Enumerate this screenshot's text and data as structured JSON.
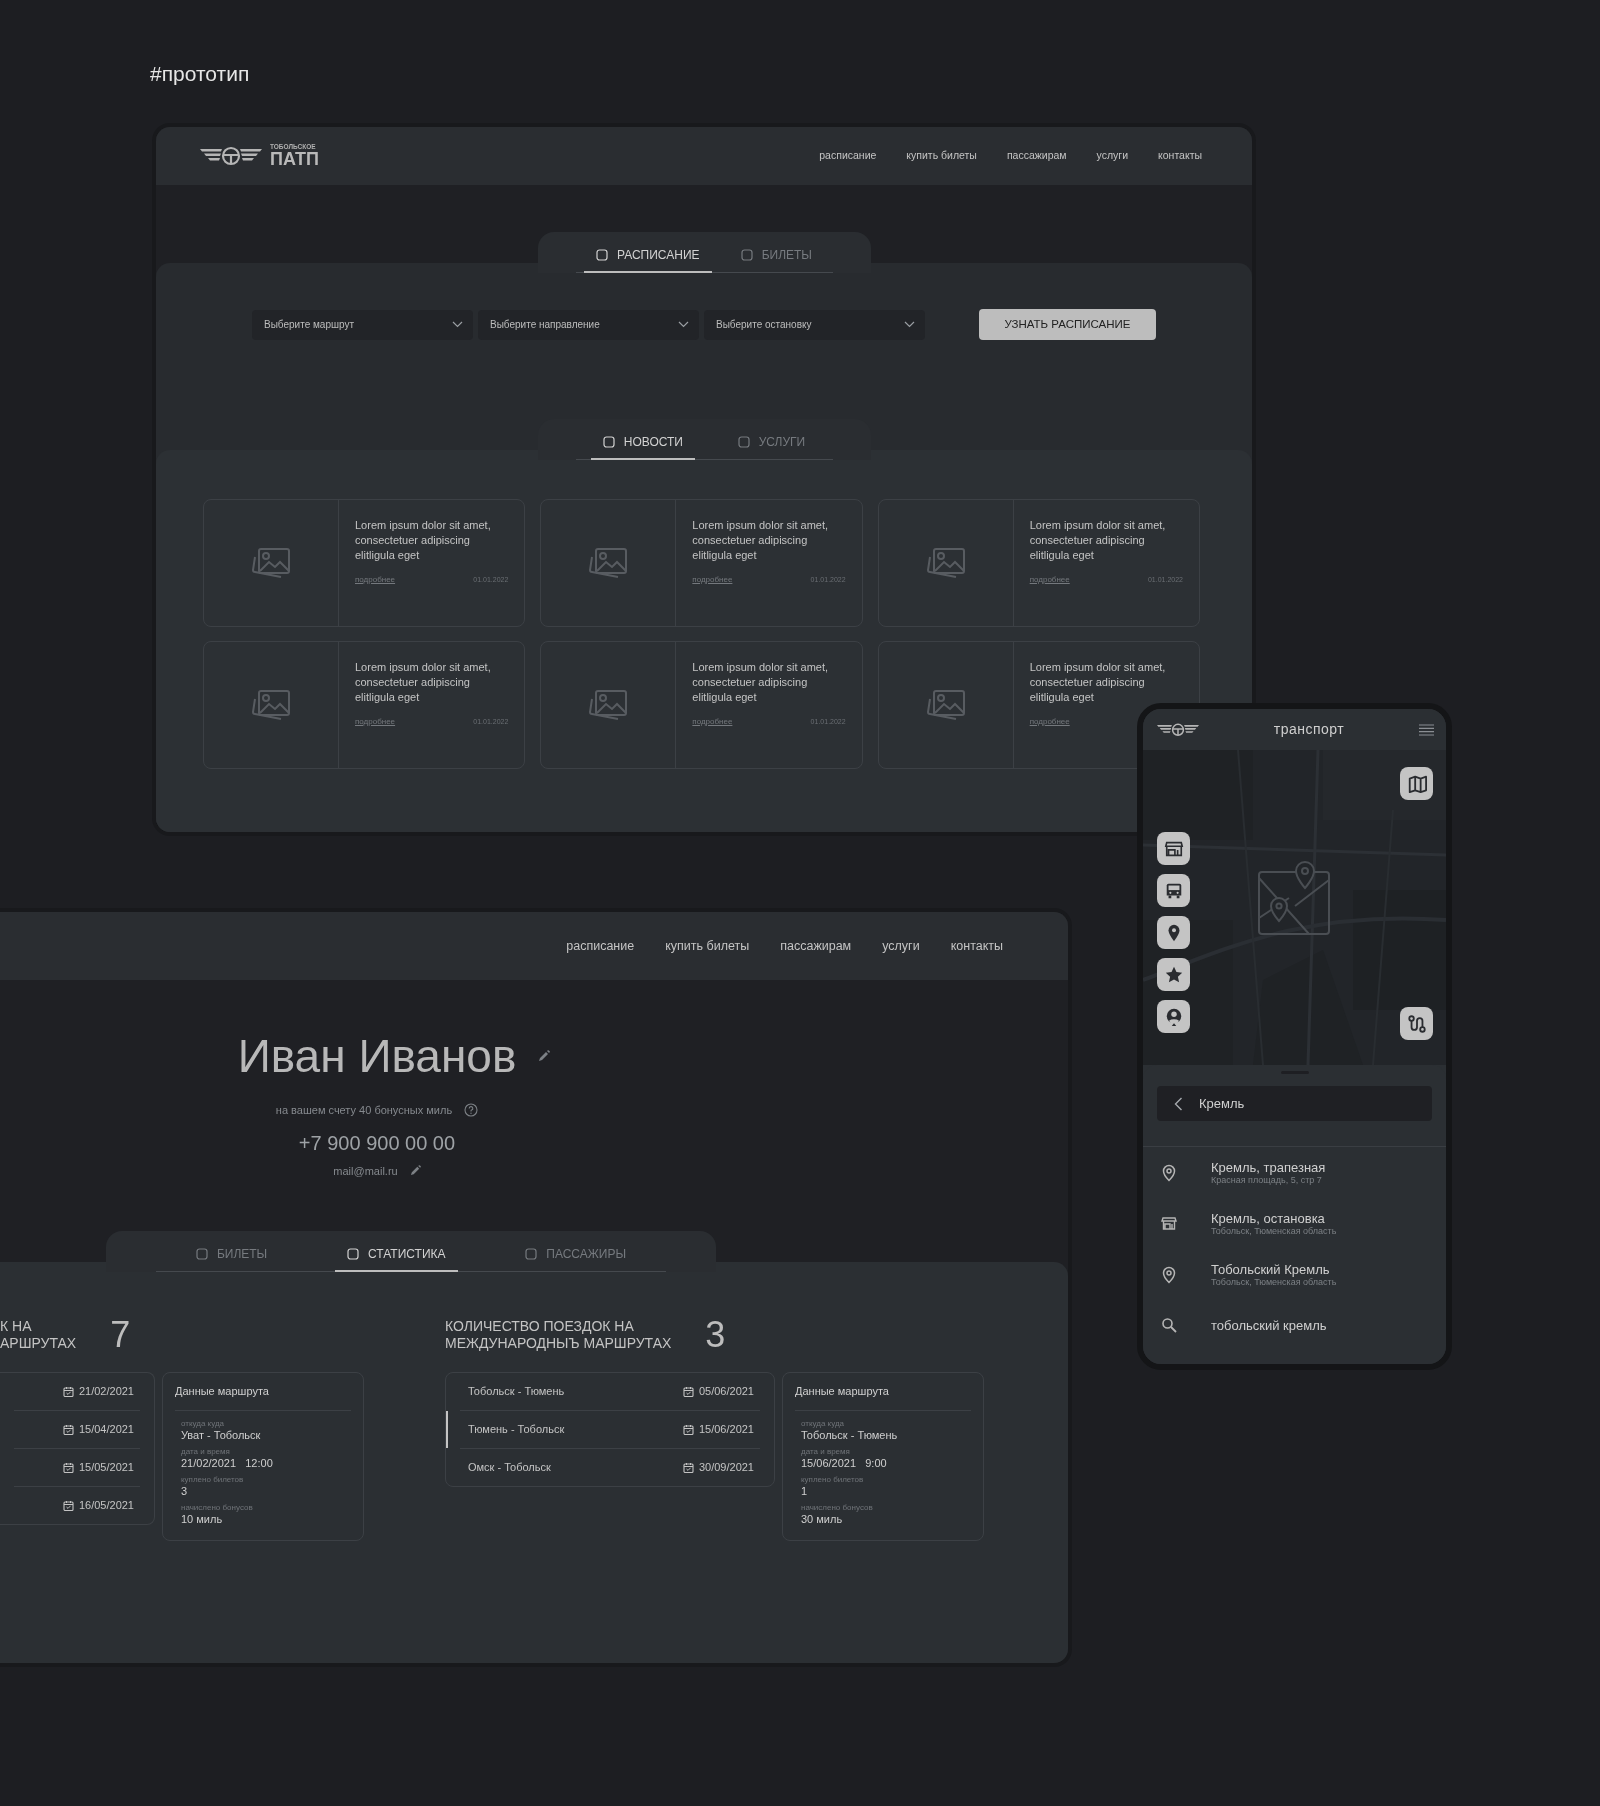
{
  "page_title": "#прототип",
  "desktop": {
    "logo": {
      "small": "ТОБОЛЬСКОЕ",
      "big": "ПАТП"
    },
    "nav": [
      "расписание",
      "купить билеты",
      "пассажирам",
      "услуги",
      "контакты"
    ],
    "schedule_tabs": [
      {
        "label": "РАСПИСАНИЕ",
        "selected": true
      },
      {
        "label": "БИЛЕТЫ",
        "selected": false
      }
    ],
    "dropdowns": [
      {
        "placeholder": "Выберите маршрут"
      },
      {
        "placeholder": "Выберите направление"
      },
      {
        "placeholder": "Выберите остановку"
      }
    ],
    "schedule_button": "УЗНАТЬ РАСПИСАНИЕ",
    "news_tabs": [
      {
        "label": "НОВОСТИ",
        "selected": true
      },
      {
        "label": "УСЛУГИ",
        "selected": false
      }
    ],
    "news": [
      {
        "text": "Lorem ipsum dolor sit amet, consectetuer adipiscing elitligula eget",
        "link": "подробнее",
        "date": "01.01.2022"
      },
      {
        "text": "Lorem ipsum dolor sit amet, consectetuer adipiscing elitligula eget",
        "link": "подробнее",
        "date": "01.01.2022"
      },
      {
        "text": "Lorem ipsum dolor sit amet, consectetuer adipiscing elitligula eget",
        "link": "подробнее",
        "date": "01.01.2022"
      },
      {
        "text": "Lorem ipsum dolor sit amet, consectetuer adipiscing elitligula eget",
        "link": "подробнее",
        "date": "01.01.2022"
      },
      {
        "text": "Lorem ipsum dolor sit amet, consectetuer adipiscing elitligula eget",
        "link": "подробнее",
        "date": "01.01.2022"
      },
      {
        "text": "Lorem ipsum dolor sit amet, consectetuer adipiscing elitligula eget",
        "link": "подробнее"
      }
    ]
  },
  "mobile": {
    "title": "транспорт",
    "search": {
      "value": "Кремль"
    },
    "results": [
      {
        "kind": "place",
        "title": "Кремль, трапезная",
        "subtitle": "Красная площадь, 5, стр 7"
      },
      {
        "kind": "stop",
        "title": "Кремль, остановка",
        "subtitle": "Тобольск, Тюменская область"
      },
      {
        "kind": "place",
        "title": "Тобольский Кремль",
        "subtitle": "Тобольск, Тюменская область"
      },
      {
        "kind": "query",
        "title": "тобольский кремль"
      }
    ]
  },
  "profile": {
    "nav": [
      "расписание",
      "купить билеты",
      "пассажирам",
      "услуги",
      "контакты"
    ],
    "name": "Иван Иванов",
    "bonus": "на вашем счету 40 бонусных миль",
    "phone": "+7 900 900 00 00",
    "email": "mail@mail.ru",
    "tabs": [
      {
        "label": "БИЛЕТЫ",
        "selected": false
      },
      {
        "label": "СТАТИСТИКА",
        "selected": true
      },
      {
        "label": "ПАССАЖИРЫ",
        "selected": false
      }
    ],
    "stats": [
      {
        "heading": [
          "К НА",
          "АРШРУТАХ"
        ],
        "count": "7",
        "trips": [
          {
            "date": "21/02/2021",
            "selected": false
          },
          {
            "date": "15/04/2021",
            "selected": false
          },
          {
            "date": "15/05/2021",
            "selected": false
          },
          {
            "date": "16/05/2021",
            "selected": false
          }
        ],
        "details": {
          "title": "Данные маршрута",
          "fields": [
            {
              "label": "откуда куда",
              "value": "Уват - Тобольск"
            },
            {
              "label": "дата и время",
              "value": "21/02/2021   12:00"
            },
            {
              "label": "куплено билетов",
              "value": "3"
            },
            {
              "label": "начислено бонусов",
              "value": "10 миль"
            }
          ]
        }
      },
      {
        "heading": [
          "КОЛИЧЕСТВО ПОЕЗДОК НА",
          "МЕЖДУНАРОДНЫЪ МАРШРУТАХ"
        ],
        "count": "3",
        "trips": [
          {
            "route": "Тобольск - Тюмень",
            "date": "05/06/2021",
            "selected": false
          },
          {
            "route": "Тюмень - Тобольск",
            "date": "15/06/2021",
            "selected": true
          },
          {
            "route": "Омск - Тобольск",
            "date": "30/09/2021",
            "selected": false
          }
        ],
        "details": {
          "title": "Данные маршрута",
          "fields": [
            {
              "label": "откуда куда",
              "value": "Тобольск - Тюмень"
            },
            {
              "label": "дата и время",
              "value": "15/06/2021   9:00"
            },
            {
              "label": "куплено билетов",
              "value": "1"
            },
            {
              "label": "начислено бонусов",
              "value": "30 миль"
            }
          ]
        }
      }
    ]
  }
}
